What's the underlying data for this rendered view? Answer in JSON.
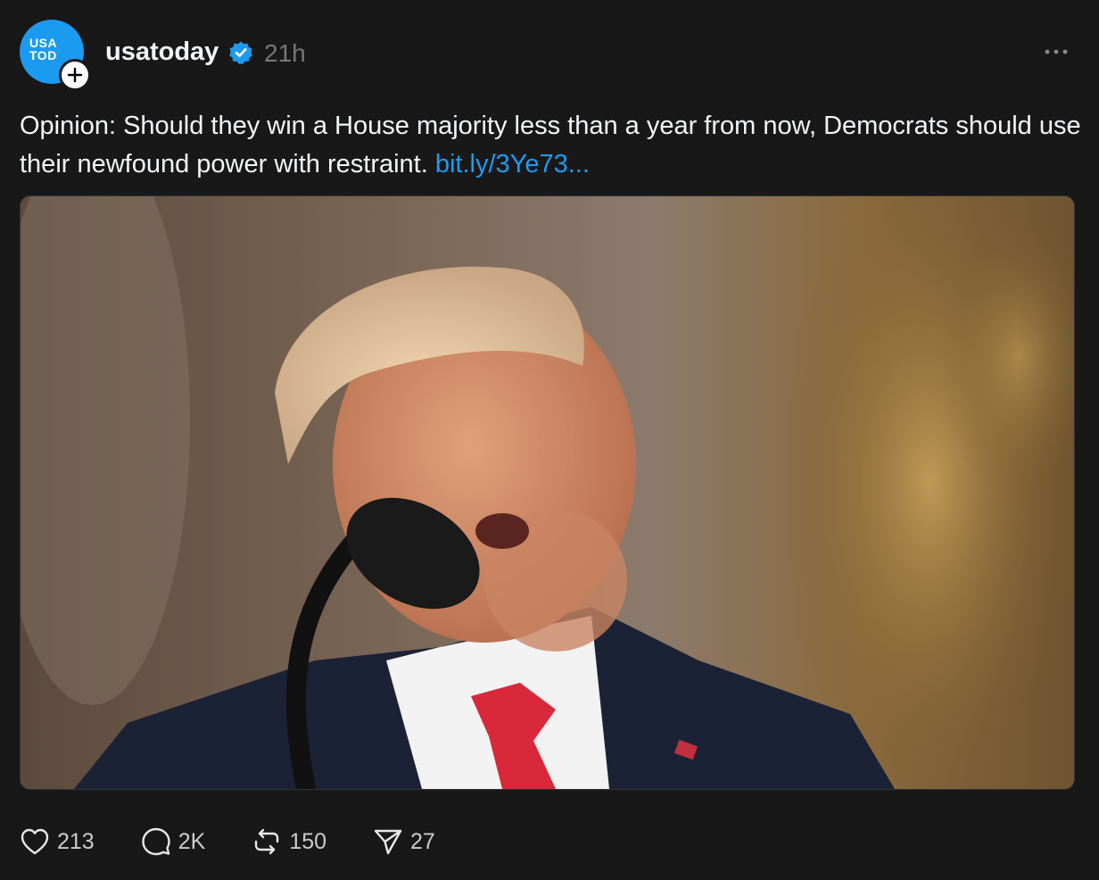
{
  "post": {
    "avatar": {
      "text": "USA\nTOD",
      "color": "#1a9bf0"
    },
    "username": "usatoday",
    "verified_icon": "verified-badge-icon",
    "timestamp": "21h",
    "more_icon": "ellipsis-icon",
    "text": "Opinion: Should they win a House majority less than a year from now, Democrats should use their newfound power with restraint. ",
    "link": "bit.ly/3Ye73...",
    "media": {
      "type": "photo"
    },
    "actions": {
      "likes": "213",
      "replies": "2K",
      "reposts": "150",
      "shares": "27"
    }
  },
  "colors": {
    "background": "#181818",
    "text": "#f3f5f7",
    "muted": "#777777",
    "link": "#1d9bf0",
    "verified": "#1d9bf0"
  }
}
